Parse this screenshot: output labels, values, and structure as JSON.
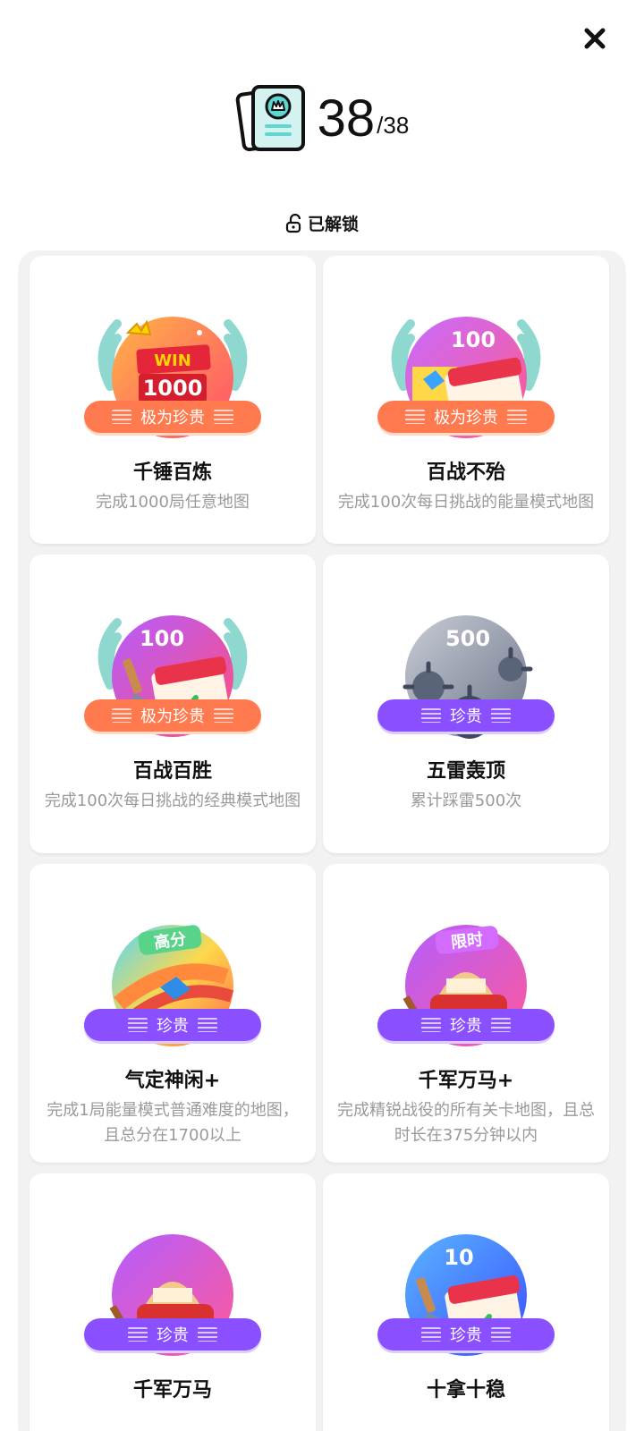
{
  "header": {
    "count": "38",
    "total": "/38"
  },
  "status": {
    "label": "已解锁"
  },
  "colors": {
    "rare_orange": "#ff7a4f",
    "rare_purple": "#8a4fff",
    "panel_bg": "#f2f2f2"
  },
  "achievements": [
    {
      "title": "千锤百炼",
      "desc": "完成1000局任意地图",
      "rarity": "极为珍贵",
      "badge_text": "WIN",
      "badge_number": "1000",
      "icon": "win-trophy-icon"
    },
    {
      "title": "百战不殆",
      "desc": "完成100次每日挑战的能量模式地图",
      "rarity": "极为珍贵",
      "badge_number": "100",
      "icon": "calendar-energy-icon"
    },
    {
      "title": "百战百胜",
      "desc": "完成100次每日挑战的经典模式地图",
      "rarity": "极为珍贵",
      "badge_number": "100",
      "icon": "calendar-shovel-icon"
    },
    {
      "title": "五雷轰顶",
      "desc": "累计踩雷500次",
      "rarity": "珍贵",
      "badge_number": "500",
      "icon": "spiked-mine-icon"
    },
    {
      "title": "气定神闲+",
      "desc": "完成1局能量模式普通难度的地图，且总分在1700以上",
      "rarity": "珍贵",
      "badge_tag": "高分",
      "icon": "rainbow-road-icon"
    },
    {
      "title": "千军万马+",
      "desc": "完成精锐战役的所有关卡地图，且总时长在375分钟以内",
      "rarity": "珍贵",
      "badge_tag": "限时",
      "icon": "knight-helmet-icon"
    },
    {
      "title": "千军万马",
      "rarity": "珍贵",
      "icon": "knight-helmet-icon"
    },
    {
      "title": "十拿十稳",
      "rarity": "珍贵",
      "badge_number": "10",
      "icon": "calendar-shovel-icon"
    }
  ]
}
